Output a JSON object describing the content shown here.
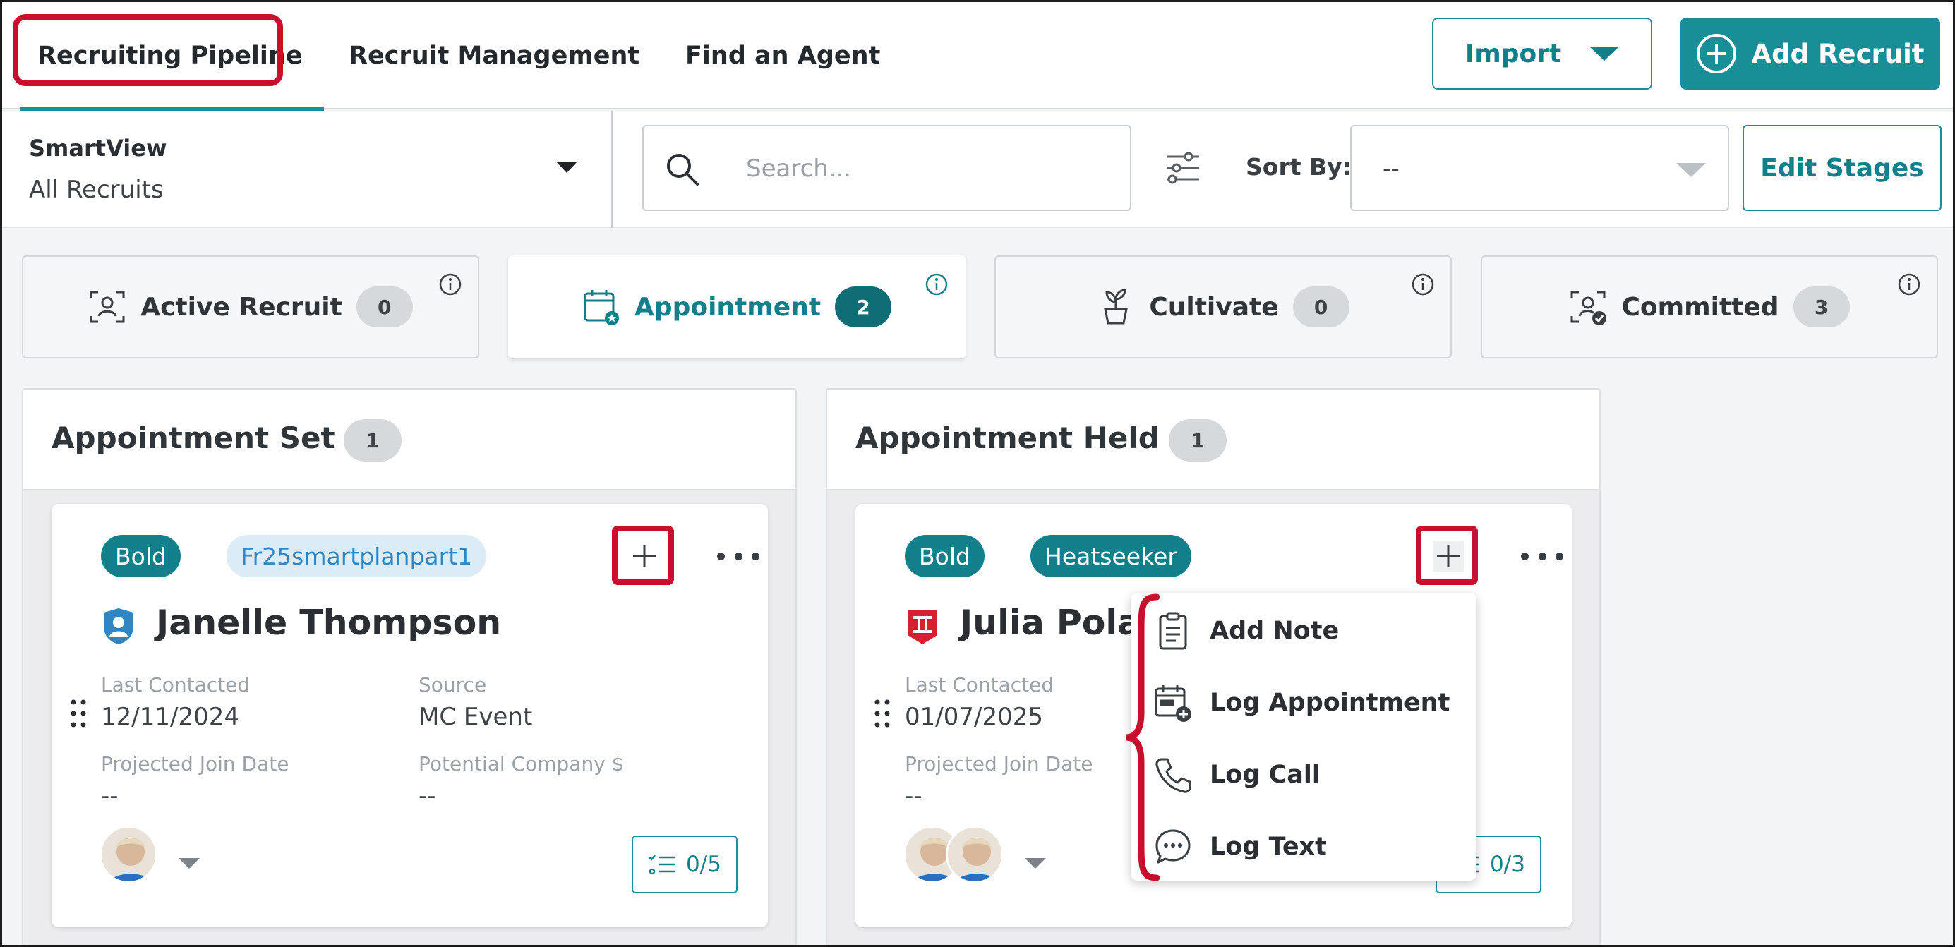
{
  "nav": {
    "tabs": [
      {
        "label": "Recruiting Pipeline",
        "active": true
      },
      {
        "label": "Recruit Management",
        "active": false
      },
      {
        "label": "Find an Agent",
        "active": false
      }
    ],
    "import_label": "Import",
    "add_recruit_label": "Add Recruit"
  },
  "filters": {
    "smartview_label": "SmartView",
    "smartview_value": "All Recruits",
    "search_placeholder": "Search...",
    "sort_label": "Sort By:",
    "sort_value": "--",
    "edit_stages_label": "Edit Stages"
  },
  "stages": [
    {
      "name": "Active Recruit",
      "count": "0",
      "icon": "person-scan-icon",
      "active": false
    },
    {
      "name": "Appointment",
      "count": "2",
      "icon": "calendar-star-icon",
      "active": true
    },
    {
      "name": "Cultivate",
      "count": "0",
      "icon": "sprout-pot-icon",
      "active": false
    },
    {
      "name": "Committed",
      "count": "3",
      "icon": "person-check-icon",
      "active": false
    }
  ],
  "columns": [
    {
      "title": "Appointment Set",
      "count": "1",
      "card": {
        "tags": [
          "Bold",
          "Fr25smartplanpart1"
        ],
        "name": "Janelle Thompson",
        "icon": "person-badge-icon",
        "fields": [
          {
            "label": "Last Contacted",
            "value": "12/11/2024"
          },
          {
            "label": "Source",
            "value": "MC Event"
          },
          {
            "label": "Projected Join Date",
            "value": "--"
          },
          {
            "label": "Potential Company $",
            "value": "--"
          }
        ],
        "tasks": "0/5"
      }
    },
    {
      "title": "Appointment Held",
      "count": "1",
      "card": {
        "tags": [
          "Bold",
          "Heatseeker"
        ],
        "name": "Julia Polar",
        "icon": "roman-two-badge-icon",
        "fields": [
          {
            "label": "Last Contacted",
            "value": "01/07/2025"
          },
          {
            "label": "Projected Join Date",
            "value": "--"
          }
        ],
        "tasks": "0/3"
      }
    }
  ],
  "menu": {
    "items": [
      {
        "label": "Add Note",
        "icon": "clipboard-icon"
      },
      {
        "label": "Log Appointment",
        "icon": "calendar-plus-icon"
      },
      {
        "label": "Log Call",
        "icon": "phone-icon"
      },
      {
        "label": "Log Text",
        "icon": "chat-bubble-icon"
      }
    ]
  },
  "colors": {
    "accent": "#188e97",
    "highlight": "#c8102e",
    "tag_light_bg": "#dcecf7"
  }
}
